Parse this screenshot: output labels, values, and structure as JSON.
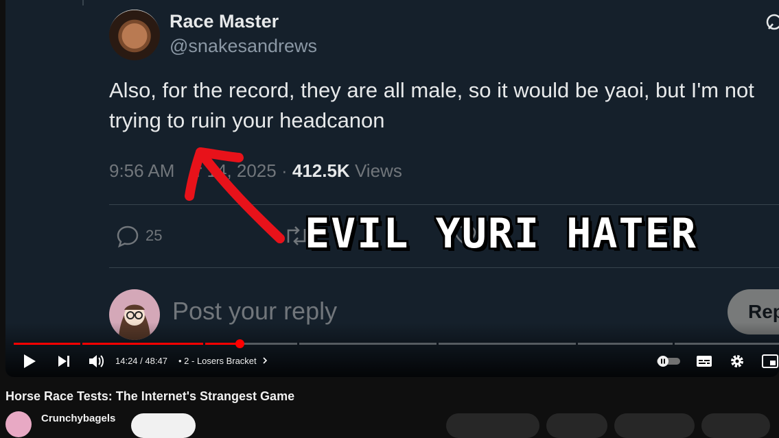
{
  "tweet": {
    "display_name": "Race Master",
    "handle": "@snakesandrews",
    "text": "Also, for the record, they are all male, so it would be yaoi, but I'm not trying to ruin your headcanon",
    "time": "9:56 AM",
    "date_partial": "r 14, 2025 ·",
    "views_count": "412.5K",
    "views_label": "Views",
    "reply_count": "25",
    "like_count": "",
    "views_partial": "7"
  },
  "reply_box": {
    "placeholder": "Post your reply",
    "button_label": "Rep"
  },
  "overlay": {
    "caption": "EVIL YURI HATER",
    "arrow_color": "#e8121a"
  },
  "player": {
    "progress_fraction": 0.295,
    "time_current": "14:24",
    "time_separator": "/",
    "time_total": "48:47",
    "chapter_label": "• 2 - Losers Bracket",
    "accent_color": "#ff0000"
  },
  "video": {
    "title": "Horse Race Tests: The Internet's Strangest Game",
    "channel_name": "Crunchybagels"
  },
  "colors": {
    "tweet_bg": "#15202b",
    "page_bg": "#0f0f0f",
    "muted_text": "#71767b"
  }
}
